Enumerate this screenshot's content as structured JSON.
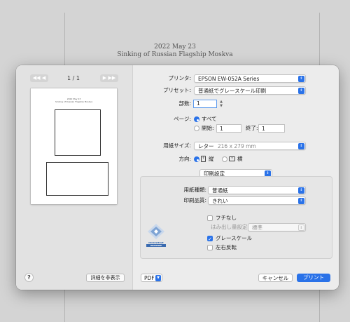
{
  "background_doc": {
    "date": "2022 May 23",
    "title": "Sinking of Russian Flagship Moskva"
  },
  "preview": {
    "prev_buttons": "◀◀ ◀",
    "next_buttons": "▶ ▶▶",
    "page_indicator": "1 / 1",
    "page_date": "2022 May 23",
    "page_title": "Sinking of Russian Flagship Moskva"
  },
  "settings": {
    "printer_label": "プリンタ:",
    "printer_value": "EPSON EW-052A Series",
    "preset_label": "プリセット:",
    "preset_value": "普通紙でグレースケール印刷",
    "copies_label": "部数:",
    "copies_value": "1",
    "pages_label": "ページ:",
    "pages_all": "すべて",
    "pages_from_label": "開始:",
    "pages_from_value": "1",
    "pages_to_label": "終了:",
    "pages_to_value": "1",
    "paper_size_label": "用紙サイズ:",
    "paper_size_value": "レター",
    "paper_size_dims": "216 x 279 mm",
    "orientation_label": "方向:",
    "orientation_portrait": "縦",
    "orientation_landscape": "横",
    "section_value": "印刷設定",
    "media_type_label": "用紙種類:",
    "media_type_value": "普通紙",
    "quality_label": "印刷品質:",
    "quality_value": "きれい",
    "borderless_label": "フチなし",
    "overflow_label": "はみ出し量設定:",
    "overflow_value": "標準",
    "grayscale_label": "グレースケール",
    "mirror_label": "左右反転"
  },
  "vendor": {
    "line1": "MICROWEAVE",
    "line2": "HEATFREE"
  },
  "footer": {
    "help": "?",
    "hide_details": "詳細を非表示",
    "pdf": "PDF",
    "cancel": "キャンセル",
    "print": "プリント"
  },
  "colors": {
    "accent": "#2a72e8",
    "dialog_bg": "#ececec",
    "sidebar_bg": "#e2e2e2"
  }
}
